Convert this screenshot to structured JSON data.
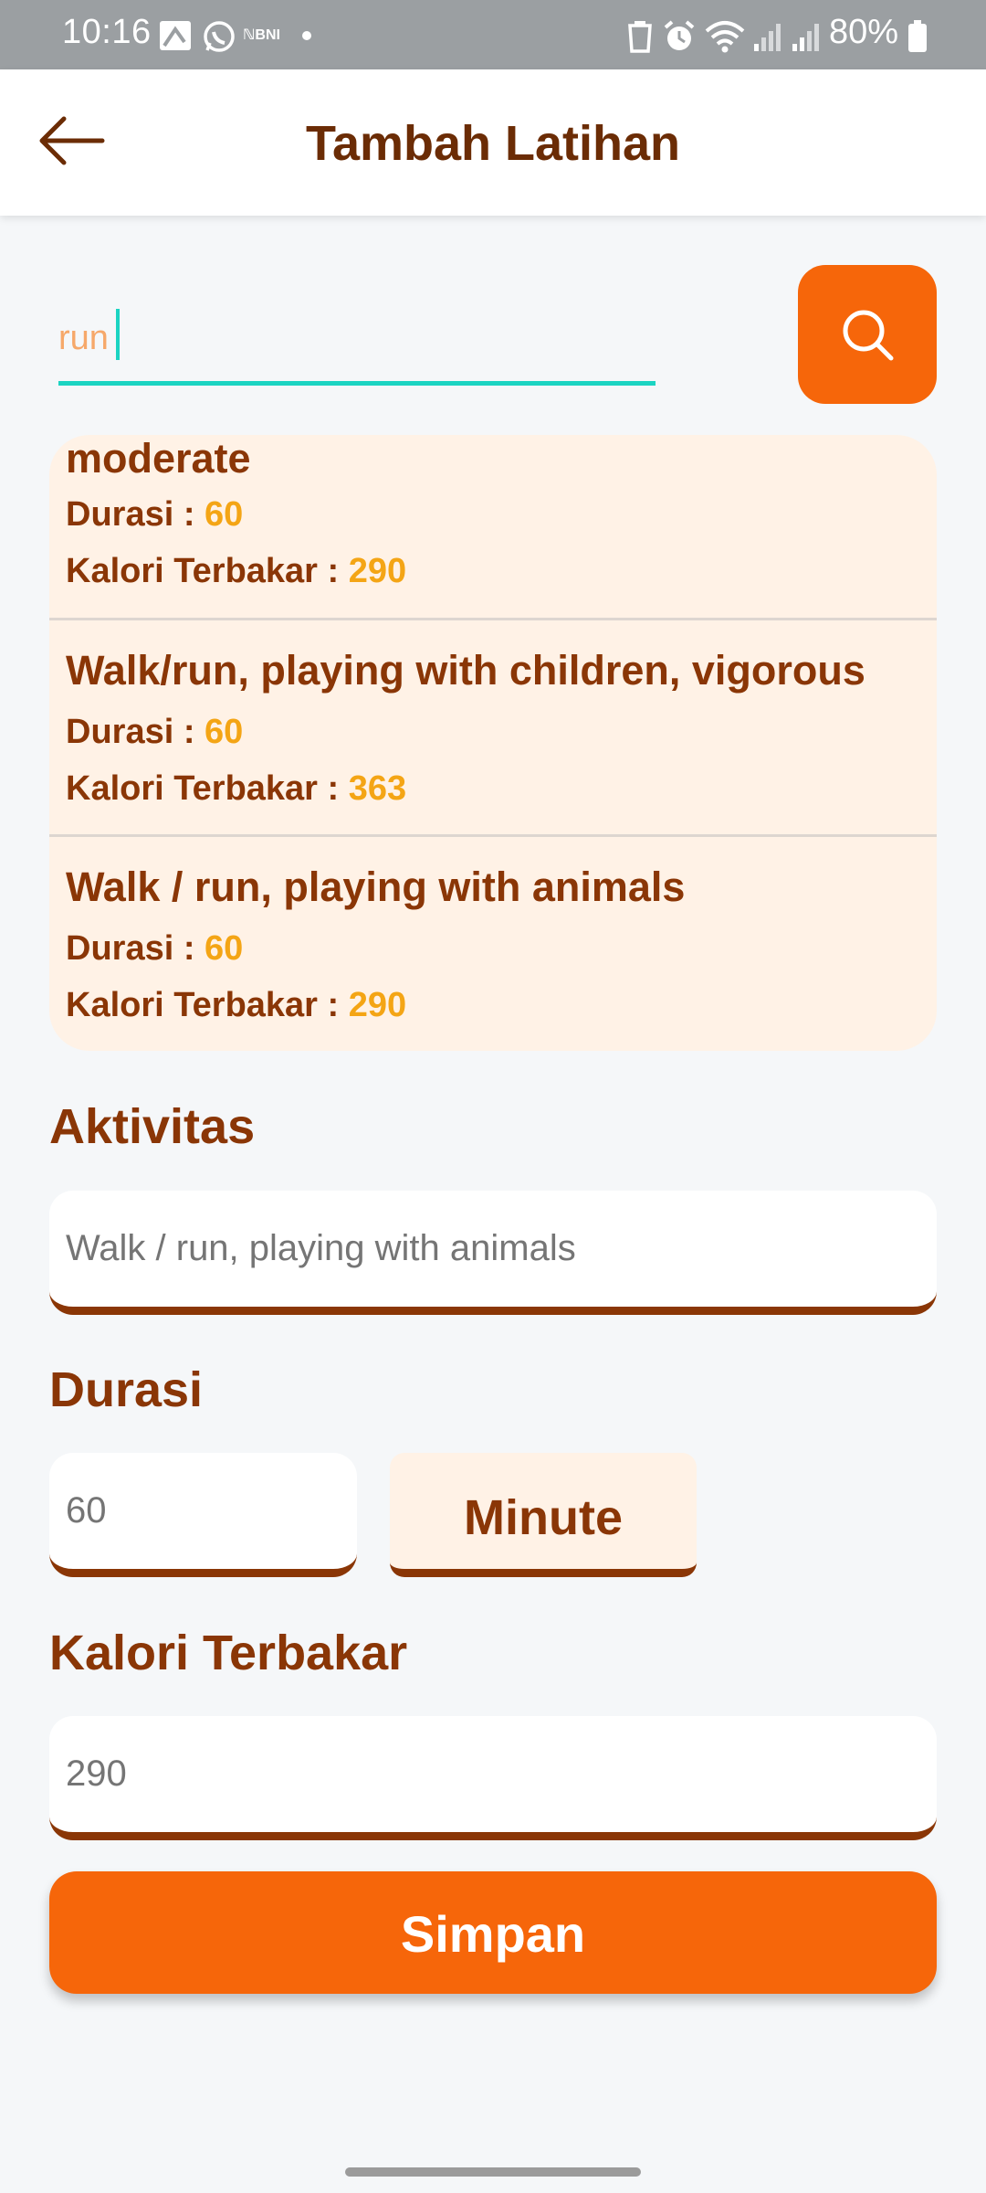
{
  "status_bar": {
    "time": "10:16",
    "battery": "80%",
    "icons": [
      "notification-icon",
      "whatsapp-icon",
      "bni-icon",
      "dot-icon",
      "recycle-icon",
      "alarm-icon",
      "wifi-icon",
      "signal-icon",
      "signal-icon",
      "battery-icon"
    ]
  },
  "header": {
    "title": "Tambah Latihan",
    "back_icon": "arrow-left-icon"
  },
  "search": {
    "value": "run",
    "button_icon": "search-icon"
  },
  "results": [
    {
      "name": "moderate",
      "durasi_label": "Durasi : ",
      "durasi": "60",
      "kalori_label": "Kalori Terbakar : ",
      "kalori": "290"
    },
    {
      "name": "Walk/run, playing with children, vigorous",
      "durasi_label": "Durasi : ",
      "durasi": "60",
      "kalori_label": "Kalori Terbakar : ",
      "kalori": "363"
    },
    {
      "name": "Walk / run, playing with animals",
      "durasi_label": "Durasi : ",
      "durasi": "60",
      "kalori_label": "Kalori Terbakar : ",
      "kalori": "290"
    }
  ],
  "form": {
    "aktivitas_label": "Aktivitas",
    "aktivitas_placeholder": "Walk / run, playing with animals",
    "durasi_label": "Durasi",
    "durasi_placeholder": "60",
    "durasi_unit": "Minute",
    "kalori_label": "Kalori Terbakar",
    "kalori_placeholder": "290",
    "save_label": "Simpan"
  },
  "colors": {
    "accent": "#f6660a",
    "brown": "#8a3606",
    "value_yellow": "#f4a515",
    "card_bg": "#fff2e6",
    "search_underline": "#1bd4c2"
  }
}
